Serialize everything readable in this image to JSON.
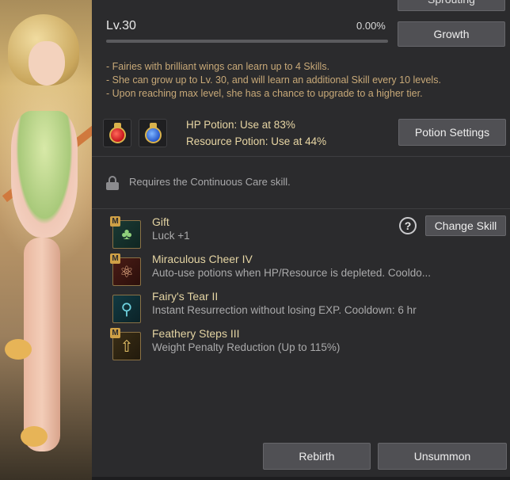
{
  "level": {
    "label": "Lv.30",
    "exp_percent": "0.00%",
    "exp_fraction": 0
  },
  "buttons": {
    "sprouting": "Sprouting",
    "growth": "Growth",
    "potion_settings": "Potion Settings",
    "change_skill": "Change Skill",
    "rebirth": "Rebirth",
    "unsummon": "Unsummon"
  },
  "description": [
    "- Fairies with brilliant wings can learn up to 4 Skills.",
    "- She can grow up to Lv. 30, and will learn an additional Skill every 10 levels.",
    "- Upon reaching max level, she has a chance to upgrade to a higher tier."
  ],
  "potions": {
    "hp": "HP Potion: Use at 83%",
    "resource": "Resource Potion: Use at 44%"
  },
  "lock_text": "Requires the Continuous Care skill.",
  "skills": [
    {
      "name": "Gift",
      "desc": "Luck +1",
      "badge": "M",
      "icon": "clover-icon"
    },
    {
      "name": "Miraculous Cheer IV",
      "desc": "Auto-use potions when HP/Resource is depleted. Cooldo...",
      "badge": "M",
      "icon": "potion-cheer-icon"
    },
    {
      "name": "Fairy's Tear II",
      "desc": "Instant Resurrection without losing EXP. Cooldown: 6 hr",
      "badge": "",
      "icon": "tear-icon"
    },
    {
      "name": "Feathery Steps III",
      "desc": "Weight Penalty Reduction (Up to 115%)",
      "badge": "M",
      "icon": "weight-icon"
    }
  ],
  "help_label": "?"
}
